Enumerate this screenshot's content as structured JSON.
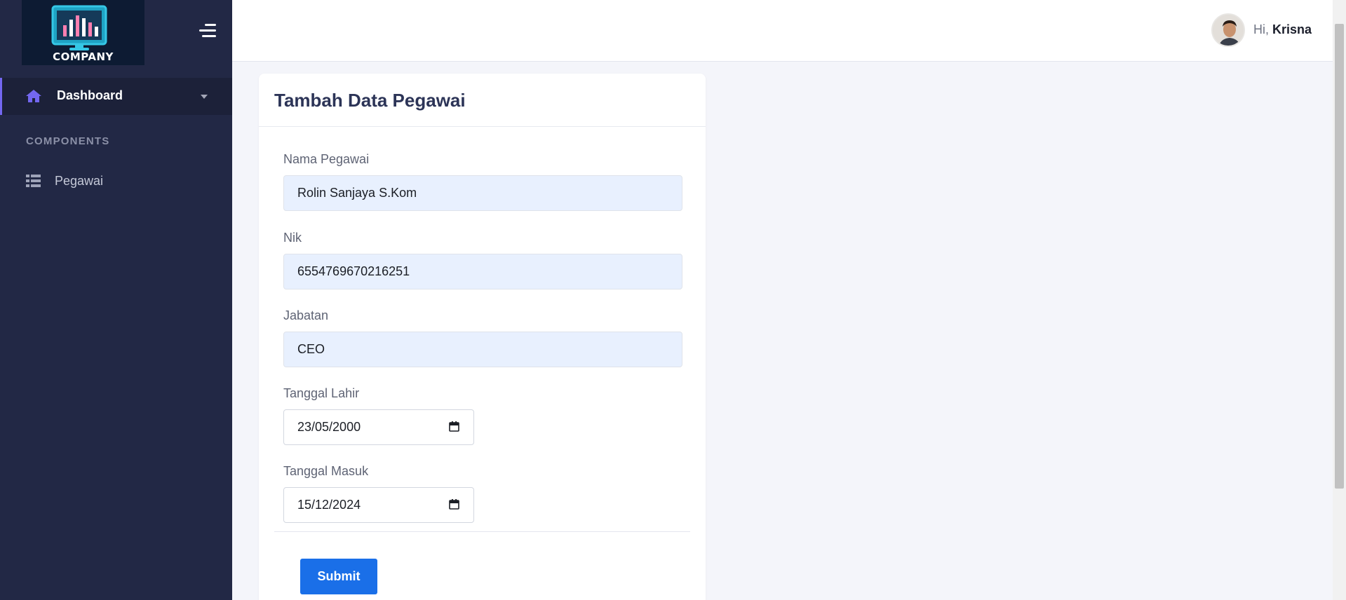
{
  "app": {
    "logo_text": "COMPANY"
  },
  "sidebar": {
    "active_item": {
      "label": "Dashboard",
      "icon": "home-icon"
    },
    "section_title": "COMPONENTS",
    "items": [
      {
        "label": "Pegawai",
        "icon": "table-list-icon"
      }
    ]
  },
  "header": {
    "greeting_prefix": "Hi,",
    "user_name": "Krisna"
  },
  "form": {
    "title": "Tambah Data Pegawai",
    "fields": {
      "nama": {
        "label": "Nama Pegawai",
        "value": "Rolin Sanjaya S.Kom"
      },
      "nik": {
        "label": "Nik",
        "value": "6554769670216251"
      },
      "jabatan": {
        "label": "Jabatan",
        "value": "CEO"
      },
      "tanggal_lahir": {
        "label": "Tanggal Lahir",
        "value": "23/05/2000"
      },
      "tanggal_masuk": {
        "label": "Tanggal Masuk",
        "value": "15/12/2024"
      }
    },
    "submit_label": "Submit"
  },
  "colors": {
    "sidebar_bg": "#222845",
    "accent": "#7367f0",
    "submit": "#1a6fe8",
    "input_bg": "#e8f0fe"
  }
}
